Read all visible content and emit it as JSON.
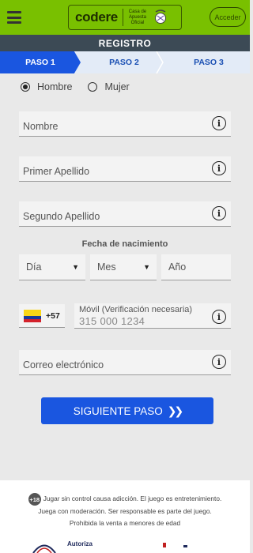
{
  "header": {
    "brand": "codere",
    "brand_sub": "Casa de Apuesta Oficial",
    "access_label": "Acceder",
    "registration_title": "REGISTRO"
  },
  "steps": [
    {
      "label": "PASO 1",
      "active": true
    },
    {
      "label": "PASO 2",
      "active": false
    },
    {
      "label": "PASO 3",
      "active": false
    }
  ],
  "gender": {
    "options": [
      "Hombre",
      "Mujer"
    ],
    "selected": "Hombre"
  },
  "fields": {
    "first_name_placeholder": "Nombre",
    "last_name1_placeholder": "Primer Apellido",
    "last_name2_placeholder": "Segundo Apellido",
    "dob_label": "Fecha de nacimiento",
    "day_placeholder": "Día",
    "month_placeholder": "Mes",
    "year_placeholder": "Año",
    "country_code": "+57",
    "phone_label": "Móvil (Verificación necesaria)",
    "phone_placeholder": "315 000 1234",
    "email_placeholder": "Correo electrónico"
  },
  "next_button_label": "SIGUIENTE PASO",
  "footer": {
    "age_badge": "+18",
    "line1": "Jugar sin control causa adicción. El juego es entretenimiento.",
    "line2": "Juega con moderación. Ser responsable es parte del juego.",
    "line3": "Prohibida la venta a menores de edad",
    "authorizes_label": "Autoriza"
  },
  "colors": {
    "brand_green": "#79c000",
    "primary_blue": "#1a56e0",
    "header_dark": "#3c4a55"
  },
  "icons": [
    "menu-icon",
    "info-icon",
    "caret-down-icon",
    "colombia-flag-icon",
    "double-chevron-right-icon"
  ]
}
